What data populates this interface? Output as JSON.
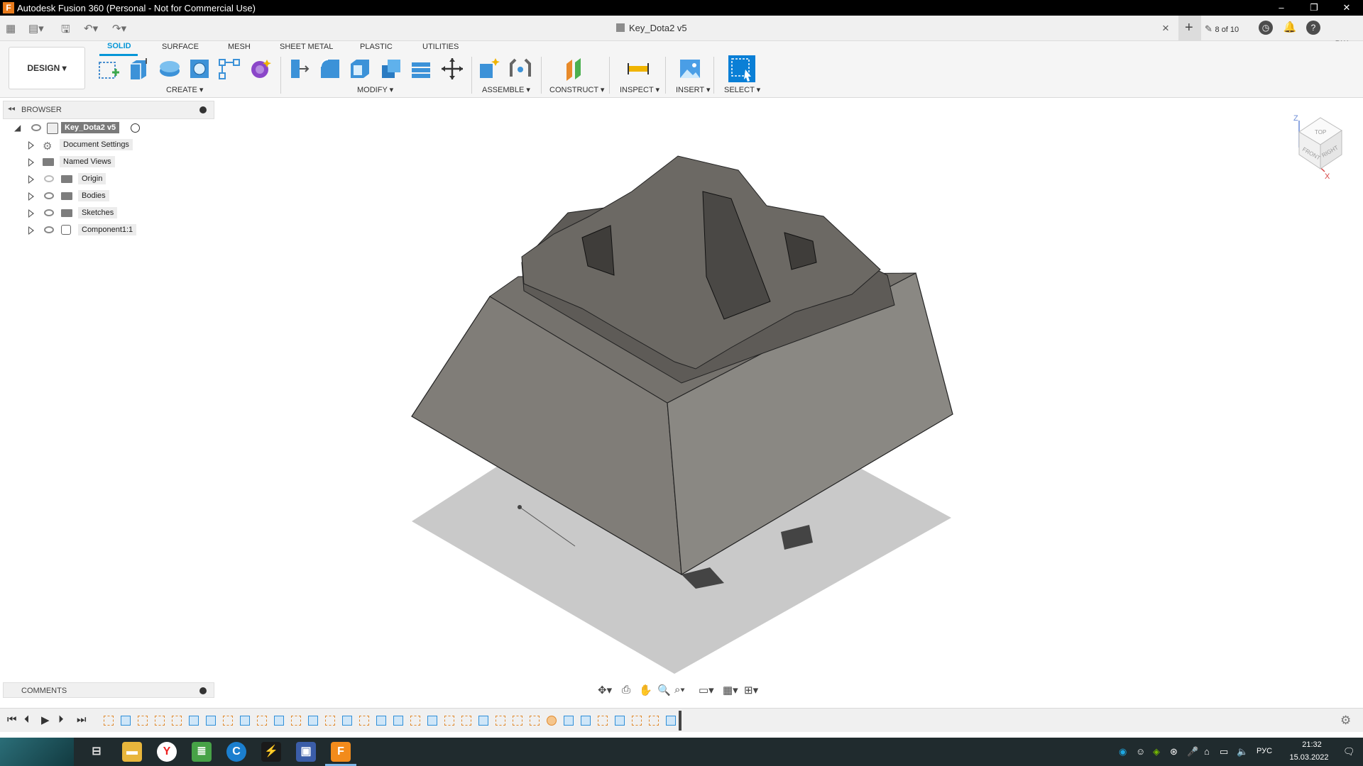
{
  "window": {
    "title": "Autodesk Fusion 360 (Personal - Not for Commercial Use)",
    "app_icon": "F",
    "minimize": "–",
    "restore": "❐",
    "close": "✕"
  },
  "document": {
    "name": "Key_Dota2 v5",
    "close": "×",
    "versions": "8 of 10",
    "user_initials": "ВЖ"
  },
  "toolbar": {
    "workspace": "DESIGN",
    "tabs": [
      "SOLID",
      "SURFACE",
      "MESH",
      "SHEET METAL",
      "PLASTIC",
      "UTILITIES"
    ],
    "active_tab": "SOLID",
    "groups": [
      "CREATE",
      "MODIFY",
      "ASSEMBLE",
      "CONSTRUCT",
      "INSPECT",
      "INSERT",
      "SELECT"
    ]
  },
  "browser": {
    "title": "BROWSER",
    "root": "Key_Dota2 v5",
    "items": [
      {
        "label": "Document Settings",
        "icon": "gear-icon"
      },
      {
        "label": "Named Views",
        "icon": "folder-icon"
      },
      {
        "label": "Origin",
        "icon": "folder-icon"
      },
      {
        "label": "Bodies",
        "icon": "folder-icon"
      },
      {
        "label": "Sketches",
        "icon": "folder-icon"
      },
      {
        "label": "Component1:1",
        "icon": "component-icon"
      }
    ]
  },
  "comments": {
    "title": "COMMENTS"
  },
  "viewcube": {
    "top": "TOP",
    "front": "FRONT",
    "right": "RIGHT",
    "axis_z": "Z",
    "axis_x": "X"
  },
  "taskbar": {
    "language": "РУС",
    "time": "21:32",
    "date": "15.03.2022"
  },
  "colors": {
    "accent": "#0696d7",
    "model_gray": "#7a7873",
    "model_top": "#6e6b66",
    "shadow": "#c8c8c8"
  }
}
